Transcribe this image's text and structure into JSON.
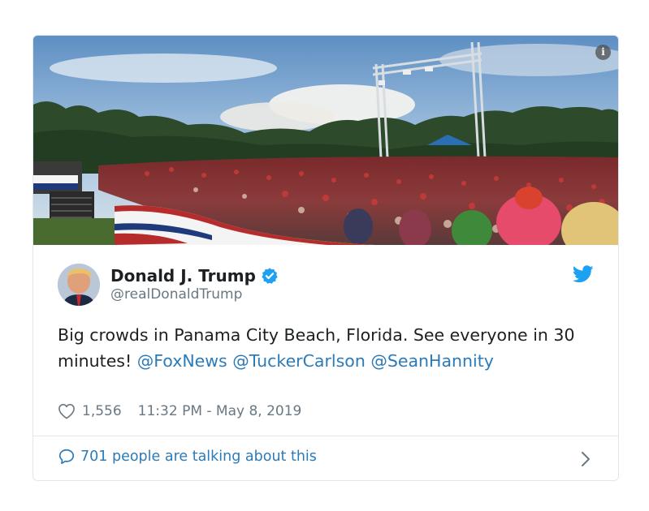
{
  "tweet": {
    "author_name": "Donald J. Trump",
    "handle": "@realDonaldTrump",
    "text_plain": "Big crowds in Panama City Beach, Florida. See everyone in 30 minutes! ",
    "mentions": [
      "@FoxNews",
      "@TuckerCarlson",
      "@SeanHannity"
    ],
    "likes": "1,556",
    "timestamp": "11:32 PM - May 8, 2019",
    "talking": "701 people are talking about this",
    "verified": true
  },
  "icons": {
    "info": "info-icon",
    "verified": "verified-badge-icon",
    "brand": "twitter-bird-icon",
    "like": "heart-icon",
    "reply": "speech-bubble-icon",
    "more": "chevron-right-icon"
  },
  "colors": {
    "link": "#2b7bb9",
    "brand": "#1da1f2",
    "muted": "#697882",
    "text": "#1c2022",
    "border": "#e1e8ed"
  }
}
